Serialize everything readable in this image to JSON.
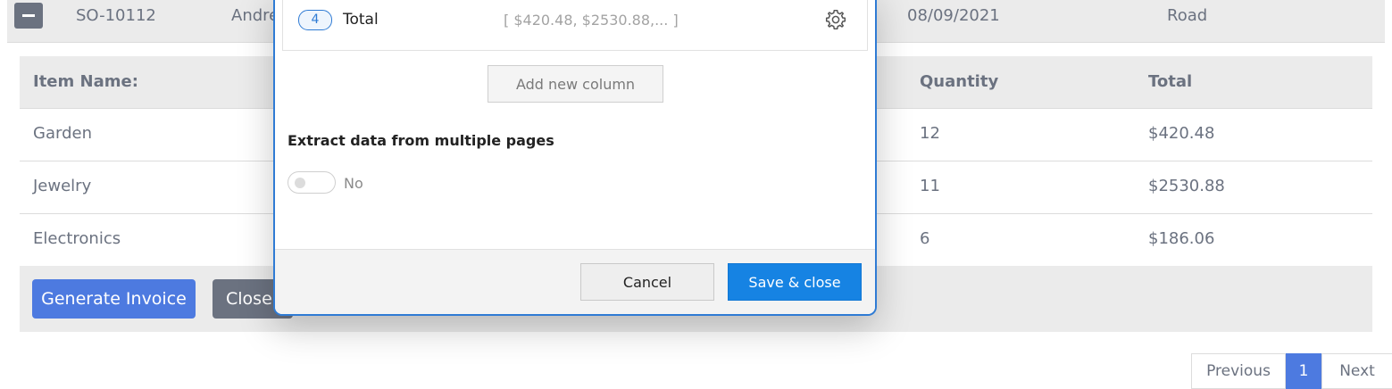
{
  "order_row": {
    "id": "SO-10112",
    "customer": "Andre",
    "date": "08/09/2021",
    "ship_via": "Road"
  },
  "items_table": {
    "headers": {
      "item_name": "Item Name:",
      "quantity": "Quantity",
      "total": "Total"
    },
    "rows": [
      {
        "item_name": "Garden",
        "quantity": "12",
        "total": "$420.48"
      },
      {
        "item_name": "Jewelry",
        "quantity": "11",
        "total": "$2530.88"
      },
      {
        "item_name": "Electronics",
        "quantity": "6",
        "total": "$186.06"
      }
    ]
  },
  "actions": {
    "generate_invoice": "Generate Invoice",
    "close": "Close"
  },
  "pagination": {
    "previous": "Previous",
    "current": "1",
    "next": "Next"
  },
  "modal": {
    "column": {
      "index": "4",
      "name": "Total",
      "preview": "[ $420.48, $2530.88,...   ]",
      "icon": "gear-icon"
    },
    "add_column_label": "Add new column",
    "extract_label": "Extract data from multiple pages",
    "toggle_value": "No",
    "cancel_label": "Cancel",
    "save_label": "Save & close"
  },
  "colors": {
    "accent": "#1683e3",
    "primary_button": "#4d7ae0",
    "secondary_button": "#6b7280"
  }
}
